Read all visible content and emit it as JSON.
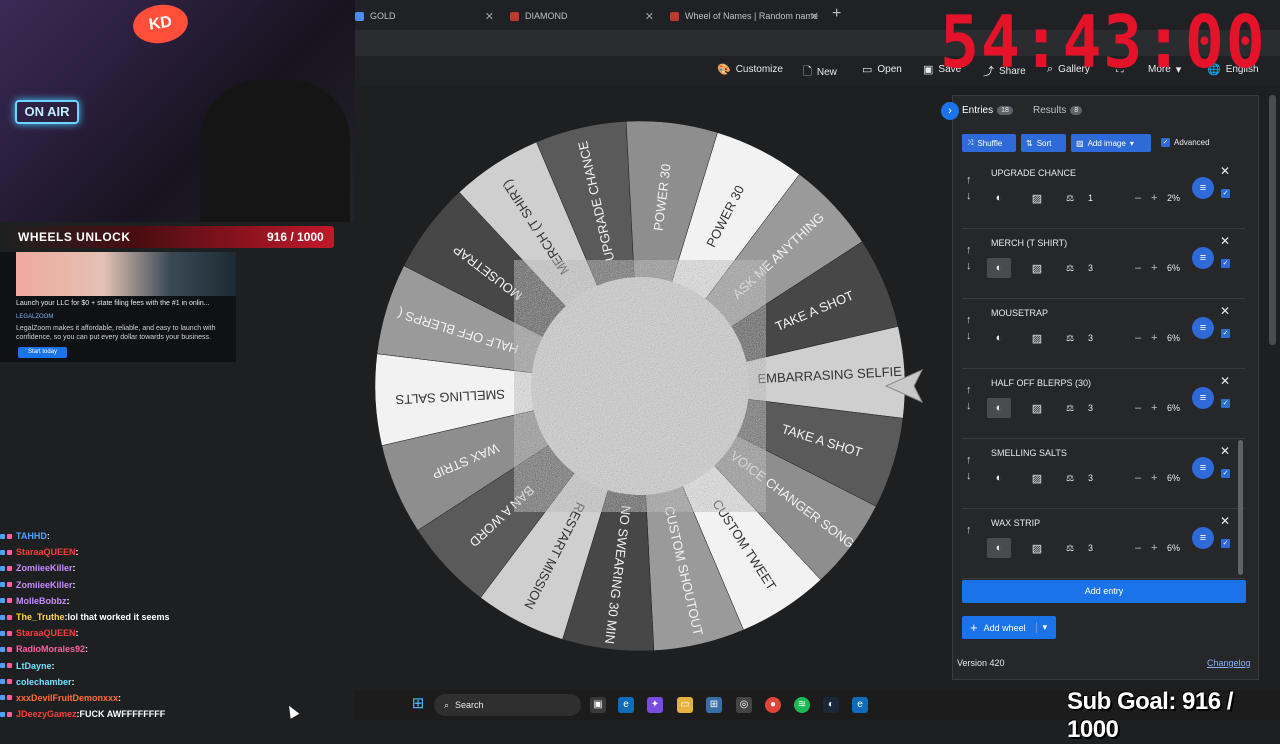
{
  "browser": {
    "tabs": [
      {
        "label": "GOLD",
        "color": "#4c8bf5"
      },
      {
        "label": "DIAMOND",
        "color": "#c0392b"
      },
      {
        "label": "Wheel of Names | Random name",
        "color": "#c0392b"
      }
    ]
  },
  "timer": "54:43:00",
  "toolbar": {
    "customize": "Customize",
    "new": "New",
    "open": "Open",
    "save": "Save",
    "share": "Share",
    "gallery": "Gallery",
    "more": "More",
    "language": "English"
  },
  "overlay": {
    "onair": "ON AIR",
    "unlock_label": "WHEELS UNLOCK",
    "unlock_count": "916 / 1000",
    "sub_goal": "Sub Goal: 916 / 1000"
  },
  "ad": {
    "headline": "Launch your LLC for $0 + state filing fees with the #1 in onlin...",
    "brand": "LEGALZOOM",
    "body": "LegalZoom makes it affordable, reliable, and easy to launch with confidence, so you can put every dollar towards your business.",
    "button": "Start today"
  },
  "chat": [
    {
      "user": "TAHHD",
      "color": "#4aa3ff",
      "msg": ""
    },
    {
      "user": "StaraaQUEEN",
      "color": "#ff3b3b",
      "msg": ""
    },
    {
      "user": "ZomiieeKiller",
      "color": "#c78bff",
      "msg": ""
    },
    {
      "user": "ZomiieeKiller",
      "color": "#c78bff",
      "msg": ""
    },
    {
      "user": "MolleBobbz",
      "color": "#c78bff",
      "msg": ""
    },
    {
      "user": "The_Truthe",
      "color": "#ffd54a",
      "msg": "lol that worked it seems"
    },
    {
      "user": "StaraaQUEEN",
      "color": "#ff3b3b",
      "msg": ""
    },
    {
      "user": "RadioMorales92",
      "color": "#ff5fa0",
      "msg": ""
    },
    {
      "user": "LtDayne",
      "color": "#6fe3ff",
      "msg": ""
    },
    {
      "user": "colechamber",
      "color": "#6fe3ff",
      "msg": ""
    },
    {
      "user": "xxxDevilFruitDemonxxx",
      "color": "#ff6d3a",
      "msg": ""
    },
    {
      "user": "JDeezyGamez",
      "color": "#ff3b3b",
      "msg": "FUCK AWFFFFFFFF"
    }
  ],
  "wheel_segments": [
    "POWER 30",
    "ASK ME ANYTHING",
    "TAKE A SHOT",
    "EMBARRASING SELFIE",
    "TAKE A SHOT",
    "VOICE CHANGER SONG",
    "CUSTOM TWEET",
    "CUSTOM SHOUTOUT",
    "NO SWEARING 30 MIN",
    "RESTART MISSION",
    "BAN A WORD",
    "WAX STRIP",
    "SMELLING SALTS",
    "HALF OFF BLERPS (",
    "MOUSETRAP",
    "MERCH (T SHIRT)",
    "UPGRADE CHANCE",
    "POWER 30"
  ],
  "panel": {
    "entries_tab": "Entries",
    "entries_count": "18",
    "results_tab": "Results",
    "results_count": "8",
    "shuffle": "Shuffle",
    "sort": "Sort",
    "add_image": "Add image",
    "advanced": "Advanced",
    "entries": [
      {
        "name": "UPGRADE CHANCE",
        "weight": "1",
        "pct": "2%"
      },
      {
        "name": "MERCH (T SHIRT)",
        "weight": "3",
        "pct": "6%"
      },
      {
        "name": "MOUSETRAP",
        "weight": "3",
        "pct": "6%"
      },
      {
        "name": "HALF OFF BLERPS (30)",
        "weight": "3",
        "pct": "6%"
      },
      {
        "name": "SMELLING SALTS",
        "weight": "3",
        "pct": "6%"
      },
      {
        "name": "WAX STRIP",
        "weight": "3",
        "pct": "6%"
      }
    ],
    "add_entry": "Add entry",
    "add_wheel": "Add wheel",
    "version": "Version 420",
    "changelog": "Changelog"
  },
  "taskbar": {
    "search": "Search"
  },
  "colors": {
    "accent": "#1a73e8",
    "timer": "#e5132a"
  }
}
